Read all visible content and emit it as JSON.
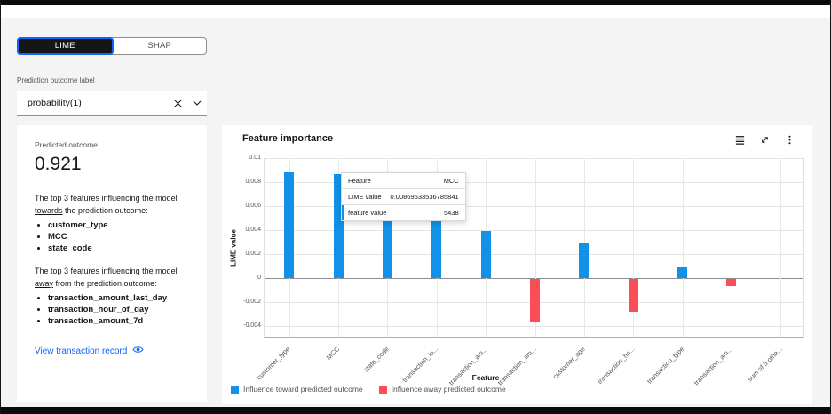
{
  "switcher": {
    "options": [
      {
        "label": "LIME",
        "selected": true
      },
      {
        "label": "SHAP",
        "selected": false
      }
    ]
  },
  "prediction_label": {
    "label": "Prediction outcome label",
    "value": "probability(1)"
  },
  "summary_card": {
    "predicted_outcome_label": "Predicted outcome",
    "predicted_outcome_value": "0.921",
    "towards_text_prefix": "The top 3 features influencing the model ",
    "towards_word": "towards",
    "towards_text_suffix": " the prediction outcome:",
    "towards_features": [
      "customer_type",
      "MCC",
      "state_code"
    ],
    "away_text_prefix": "The top 3 features influencing the model ",
    "away_word": "away",
    "away_text_suffix": " from the prediction outcome:",
    "away_features": [
      "transaction_amount_last_day",
      "transaction_hour_of_day",
      "transaction_amount_7d"
    ],
    "link_label": "View transaction record"
  },
  "chart_card": {
    "title": "Feature importance",
    "toolbar_icons": [
      "data-table-icon",
      "maximize-icon",
      "overflow-menu-icon"
    ]
  },
  "tooltip": {
    "rows": [
      {
        "label": "Feature",
        "value": "MCC"
      },
      {
        "label": "LIME value",
        "value": "0.00869633536785841"
      },
      {
        "label": "feature value",
        "value": "5438"
      }
    ]
  },
  "chart_data": {
    "type": "bar",
    "title": "Feature importance",
    "xlabel": "Feature",
    "ylabel": "LIME value",
    "ylim": [
      -0.005,
      0.01
    ],
    "yticks": [
      0.01,
      0.008,
      0.006,
      0.004,
      0.002,
      0,
      -0.002,
      -0.004
    ],
    "grid": true,
    "legend_position": "bottom",
    "categories": [
      "customer_type",
      "MCC",
      "state_code",
      "transaction_lo...",
      "transaction_am...",
      "transaction_am...",
      "customer_age",
      "transaction_ho...",
      "transaction_type",
      "transaction_am...",
      "sum of 3 othe..."
    ],
    "values": [
      0.0088,
      0.00869633536785841,
      0.0055,
      0.0051,
      0.0039,
      -0.0037,
      0.0029,
      -0.0028,
      0.0009,
      -0.0006,
      0
    ],
    "colors": {
      "positive": "#1192e8",
      "negative": "#fa4d56"
    },
    "legend": [
      {
        "label": "Influence toward predicted outcome",
        "color": "#1192e8"
      },
      {
        "label": "Influence away predicted outcome",
        "color": "#fa4d56"
      }
    ]
  }
}
